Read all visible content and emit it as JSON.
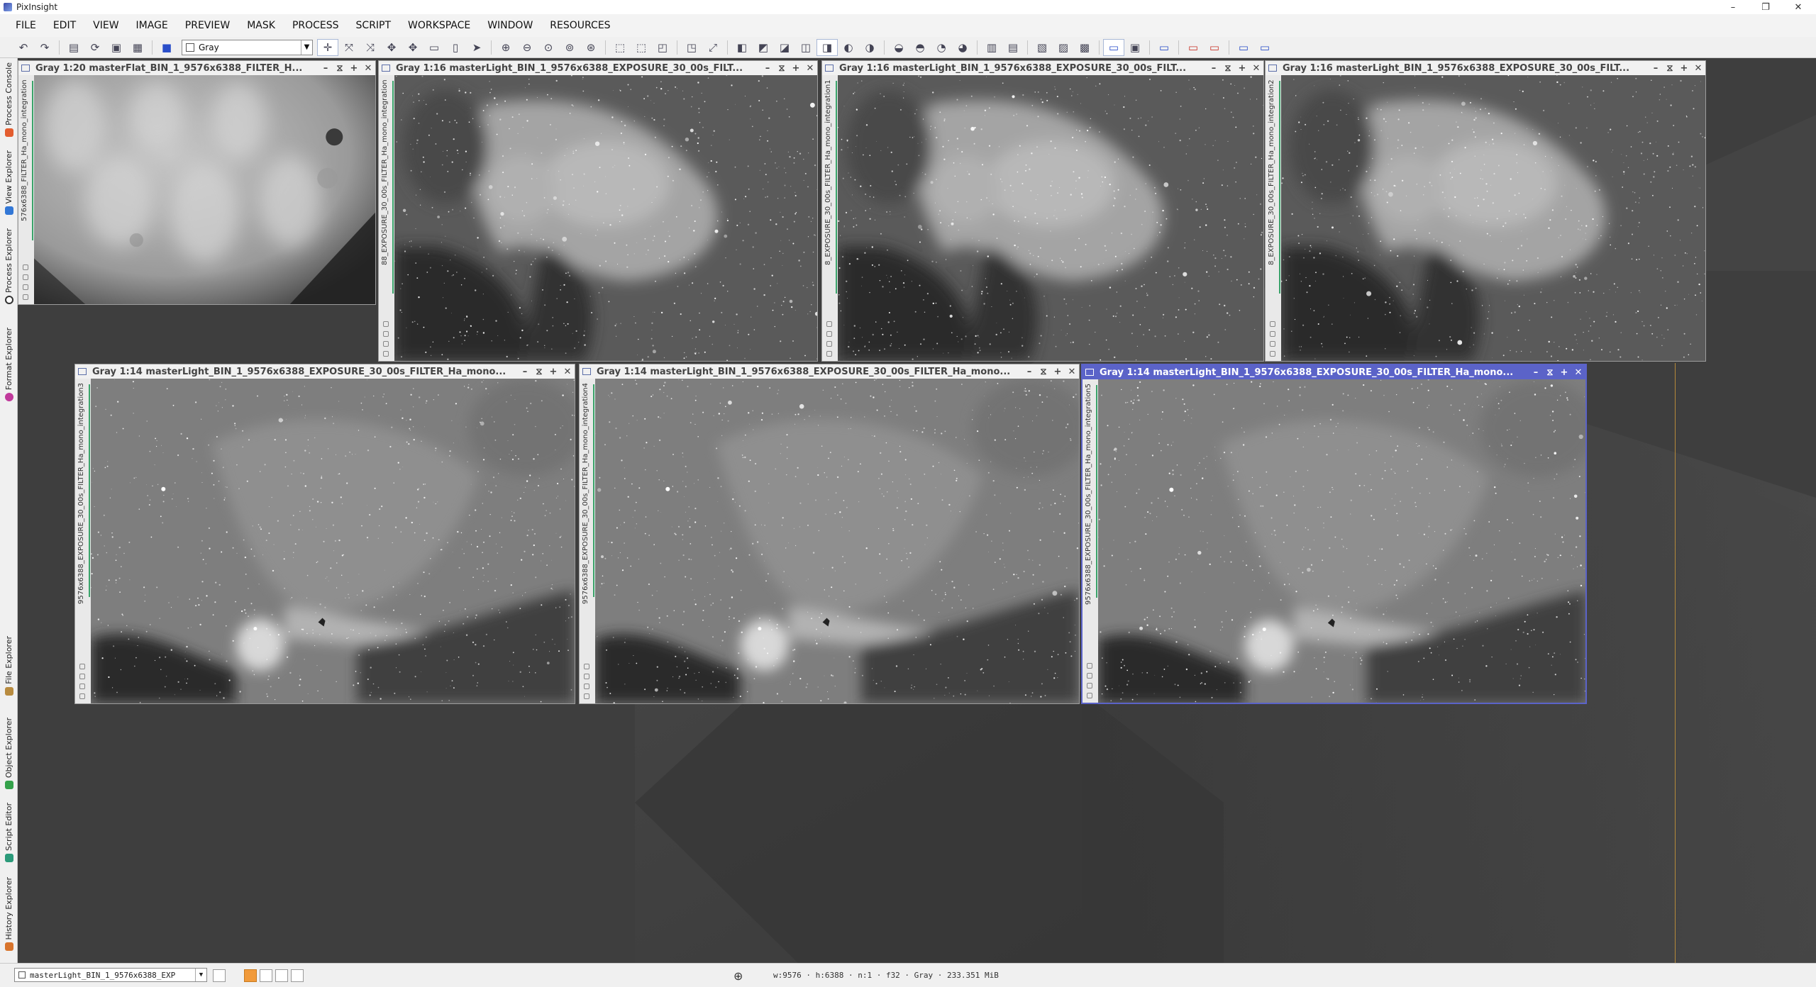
{
  "app": {
    "title": "PixInsight"
  },
  "window_controls": {
    "minimize": "–",
    "restore": "❐",
    "close": "✕"
  },
  "menu": [
    "FILE",
    "EDIT",
    "VIEW",
    "IMAGE",
    "PREVIEW",
    "MASK",
    "PROCESS",
    "SCRIPT",
    "WORKSPACE",
    "WINDOW",
    "RESOURCES"
  ],
  "toolbar": {
    "color_space_select": "Gray"
  },
  "left_dock": {
    "tabs": [
      {
        "label": "Process Console",
        "icon": "console-icon",
        "color": "#e35d2f"
      },
      {
        "label": "View Explorer",
        "icon": "view-explorer-icon",
        "color": "#3277d6"
      },
      {
        "label": "Process Explorer",
        "icon": "process-explorer-icon",
        "color": "#333333"
      },
      {
        "label": "Format Explorer",
        "icon": "format-explorer-icon",
        "color": "#c0399b"
      },
      {
        "label": "File Explorer",
        "icon": "file-explorer-icon",
        "color": "#b88b3f"
      },
      {
        "label": "Object Explorer",
        "icon": "object-explorer-icon",
        "color": "#34a14a"
      },
      {
        "label": "Script Editor",
        "icon": "script-editor-icon",
        "color": "#2b9a7a"
      },
      {
        "label": "History Explorer",
        "icon": "history-explorer-icon",
        "color": "#d8742c"
      }
    ]
  },
  "image_windows": [
    {
      "title": "Gray 1:20 masterFlat_BIN_1_9576x6388_FILTER_H...",
      "side_label": "576x6388_FILTER_Ha_mono_integration",
      "image": "flat",
      "active": false
    },
    {
      "title": "Gray 1:16 masterLight_BIN_1_9576x6388_EXPOSURE_30_00s_FILT...",
      "side_label": "88_EXPOSURE_30_00s_FILTER_Ha_mono_integration",
      "image": "na",
      "active": false
    },
    {
      "title": "Gray 1:16 masterLight_BIN_1_9576x6388_EXPOSURE_30_00s_FILT...",
      "side_label": "8_EXPOSURE_30_00s_FILTER_Ha_mono_integration1",
      "image": "na",
      "active": false
    },
    {
      "title": "Gray 1:16 masterLight_BIN_1_9576x6388_EXPOSURE_30_00s_FILT...",
      "side_label": "8_EXPOSURE_30_00s_FILTER_Ha_mono_integration2",
      "image": "na",
      "active": false
    },
    {
      "title": "Gray 1:14 masterLight_BIN_1_9576x6388_EXPOSURE_30_00s_FILTER_Ha_mono...",
      "side_label": "9576x6388_EXPOSURE_30_00s_FILTER_Ha_mono_integration3",
      "image": "horse",
      "active": false
    },
    {
      "title": "Gray 1:14 masterLight_BIN_1_9576x6388_EXPOSURE_30_00s_FILTER_Ha_mono...",
      "side_label": "9576x6388_EXPOSURE_30_00s_FILTER_Ha_mono_integration4",
      "image": "horse",
      "active": false
    },
    {
      "title": "Gray 1:14 masterLight_BIN_1_9576x6388_EXPOSURE_30_00s_FILTER_Ha_mono...",
      "side_label": "9576x6388_EXPOSURE_30_00s_FILTER_Ha_mono_integration5",
      "image": "horse",
      "active": true
    }
  ],
  "window_buttons": {
    "minimize": "–",
    "shade": "⧖",
    "maximize": "+",
    "close": "✕"
  },
  "status_bar": {
    "view_selector": "masterLight_BIN_1_9576x6388_EXP",
    "info": "w:9576 · h:6388 · n:1 · f32 · Gray · 233.351 MiB"
  },
  "colors": {
    "accent": "#5b63c8",
    "workspace": "#3d3d3d"
  }
}
